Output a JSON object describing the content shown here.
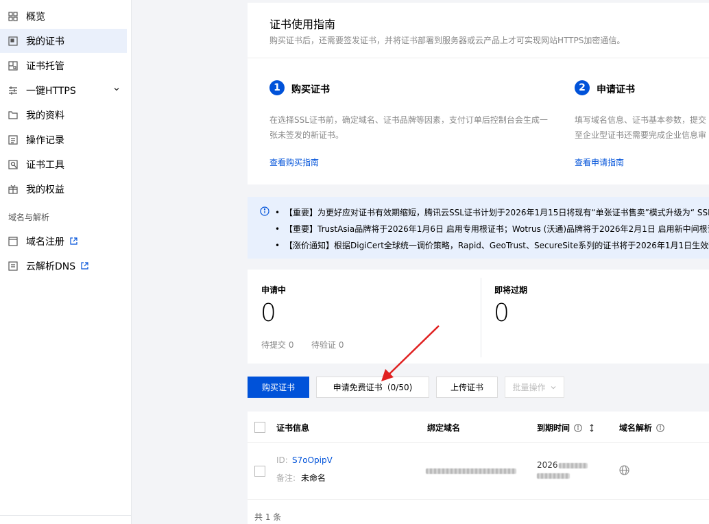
{
  "sidebar": {
    "items": [
      {
        "label": "概览",
        "icon": "grid-icon"
      },
      {
        "label": "我的证书",
        "icon": "certificate-icon"
      },
      {
        "label": "证书托管",
        "icon": "hosting-icon"
      },
      {
        "label": "一键HTTPS",
        "icon": "sliders-icon"
      },
      {
        "label": "我的资料",
        "icon": "folder-icon"
      },
      {
        "label": "操作记录",
        "icon": "list-icon"
      },
      {
        "label": "证书工具",
        "icon": "tool-icon"
      },
      {
        "label": "我的权益",
        "icon": "gift-icon"
      }
    ],
    "section_label": "域名与解析",
    "domain_items": [
      {
        "label": "域名注册",
        "icon": "domain-icon"
      },
      {
        "label": "云解析DNS",
        "icon": "dns-icon"
      }
    ]
  },
  "guide": {
    "title": "证书使用指南",
    "subtitle": "购买证书后，还需要签发证书，并将证书部署到服务器或云产品上才可实现网站HTTPS加密通信。",
    "steps": [
      {
        "num": "1",
        "title": "购买证书",
        "desc": "在选择SSL证书前，确定域名、证书品牌等因素，支付订单后控制台会生成一张未签发的新证书。",
        "link": "查看购买指南"
      },
      {
        "num": "2",
        "title": "申请证书",
        "desc": "填写域名信息、证书基本参数，提交至企业型证书还需要完成企业信息审核。",
        "link": "查看申请指南"
      }
    ]
  },
  "notices": [
    "【重要】为更好应对证书有效期缩短，腾讯云SSL证书计划于2026年1月15日将现有“单张证书售卖”模式升级为“ SSL",
    "【重要】TrustAsia品牌将于2026年1月6日 启用专用根证书；Wotrus (沃通)品牌将于2026年2月1日 启用新中间根证书",
    "【涨价通知】根据DigiCert全球统一调价策略，Rapid、GeoTrust、SecureSite系列的证书将于2026年1月1日生效新价"
  ],
  "stats": {
    "pending": {
      "label": "申请中",
      "value": "0",
      "sub1": "待提交 0",
      "sub2": "待验证 0"
    },
    "expiring": {
      "label": "即将过期",
      "value": "0"
    }
  },
  "toolbar": {
    "buy": "购买证书",
    "free": "申请免费证书（0/50)",
    "upload": "上传证书",
    "batch": "批量操作"
  },
  "table": {
    "headers": {
      "info": "证书信息",
      "domain": "绑定域名",
      "expire": "到期时间",
      "dns": "域名解析"
    },
    "rows": [
      {
        "id_label": "ID:",
        "id": "S7oOpipV",
        "note_label": "备注:",
        "note": "未命名",
        "expire_partial": "2026"
      }
    ],
    "total": "共 1 条"
  },
  "colors": {
    "primary": "#0052d9",
    "notice_bg": "#e8f0fd",
    "arrow": "#e02020"
  }
}
